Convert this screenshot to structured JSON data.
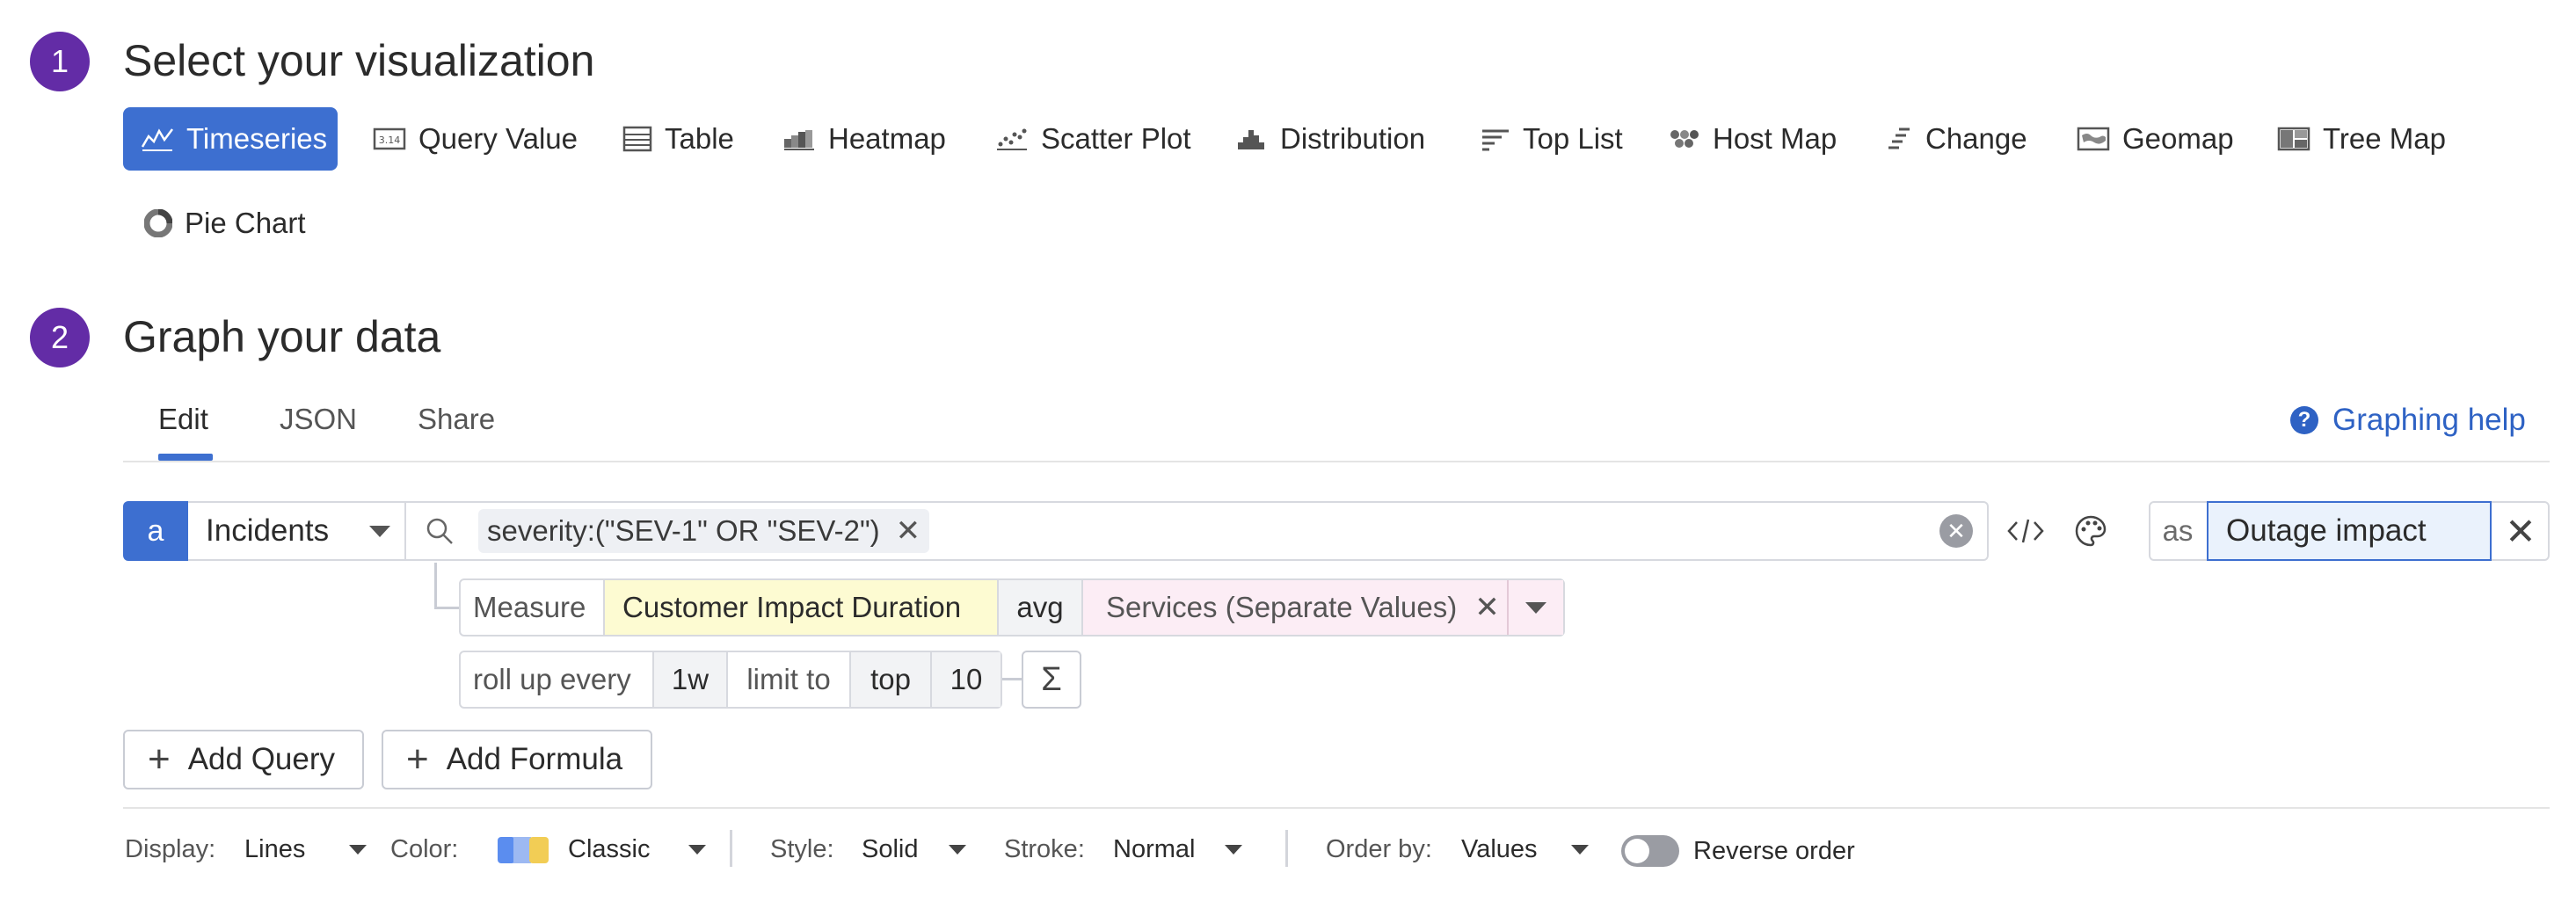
{
  "step1": {
    "number": "1",
    "title": "Select your visualization"
  },
  "visualizations": [
    {
      "label": "Timeseries",
      "icon": "timeseries-icon",
      "active": true
    },
    {
      "label": "Query Value",
      "icon": "query-value-icon"
    },
    {
      "label": "Table",
      "icon": "table-icon"
    },
    {
      "label": "Heatmap",
      "icon": "heatmap-icon"
    },
    {
      "label": "Scatter Plot",
      "icon": "scatter-plot-icon"
    },
    {
      "label": "Distribution",
      "icon": "distribution-icon"
    },
    {
      "label": "Top List",
      "icon": "top-list-icon"
    },
    {
      "label": "Host Map",
      "icon": "host-map-icon"
    },
    {
      "label": "Change",
      "icon": "change-icon"
    },
    {
      "label": "Geomap",
      "icon": "geomap-icon"
    },
    {
      "label": "Tree Map",
      "icon": "tree-map-icon"
    },
    {
      "label": "Pie Chart",
      "icon": "pie-chart-icon"
    }
  ],
  "step2": {
    "number": "2",
    "title": "Graph your data"
  },
  "tabs": [
    "Edit",
    "JSON",
    "Share"
  ],
  "help": {
    "label": "Graphing help"
  },
  "query": {
    "letter": "a",
    "source": "Incidents",
    "filter_chip": "severity:(\"SEV-1\" OR \"SEV-2\")",
    "alias_prefix": "as",
    "alias_value": "Outage impact",
    "measure_label": "Measure",
    "measure_value": "Customer Impact Duration",
    "aggregation": "avg",
    "group_by": "Services (Separate Values)",
    "rollup_label": "roll up every",
    "rollup_value": "1w",
    "limit_label": "limit to",
    "limit_direction": "top",
    "limit_count": "10",
    "sigma": "Σ"
  },
  "buttons": {
    "add_query": "Add Query",
    "add_formula": "Add Formula"
  },
  "options": {
    "display_label": "Display:",
    "display_value": "Lines",
    "color_label": "Color:",
    "color_value": "Classic",
    "style_label": "Style:",
    "style_value": "Solid",
    "stroke_label": "Stroke:",
    "stroke_value": "Normal",
    "order_label": "Order by:",
    "order_value": "Values",
    "reverse_label": "Reverse order"
  },
  "colors": {
    "accent": "#3d6fd0",
    "step": "#632ca6",
    "measure_bg": "#fdfbd2",
    "groupby_bg": "#fcedf5"
  }
}
